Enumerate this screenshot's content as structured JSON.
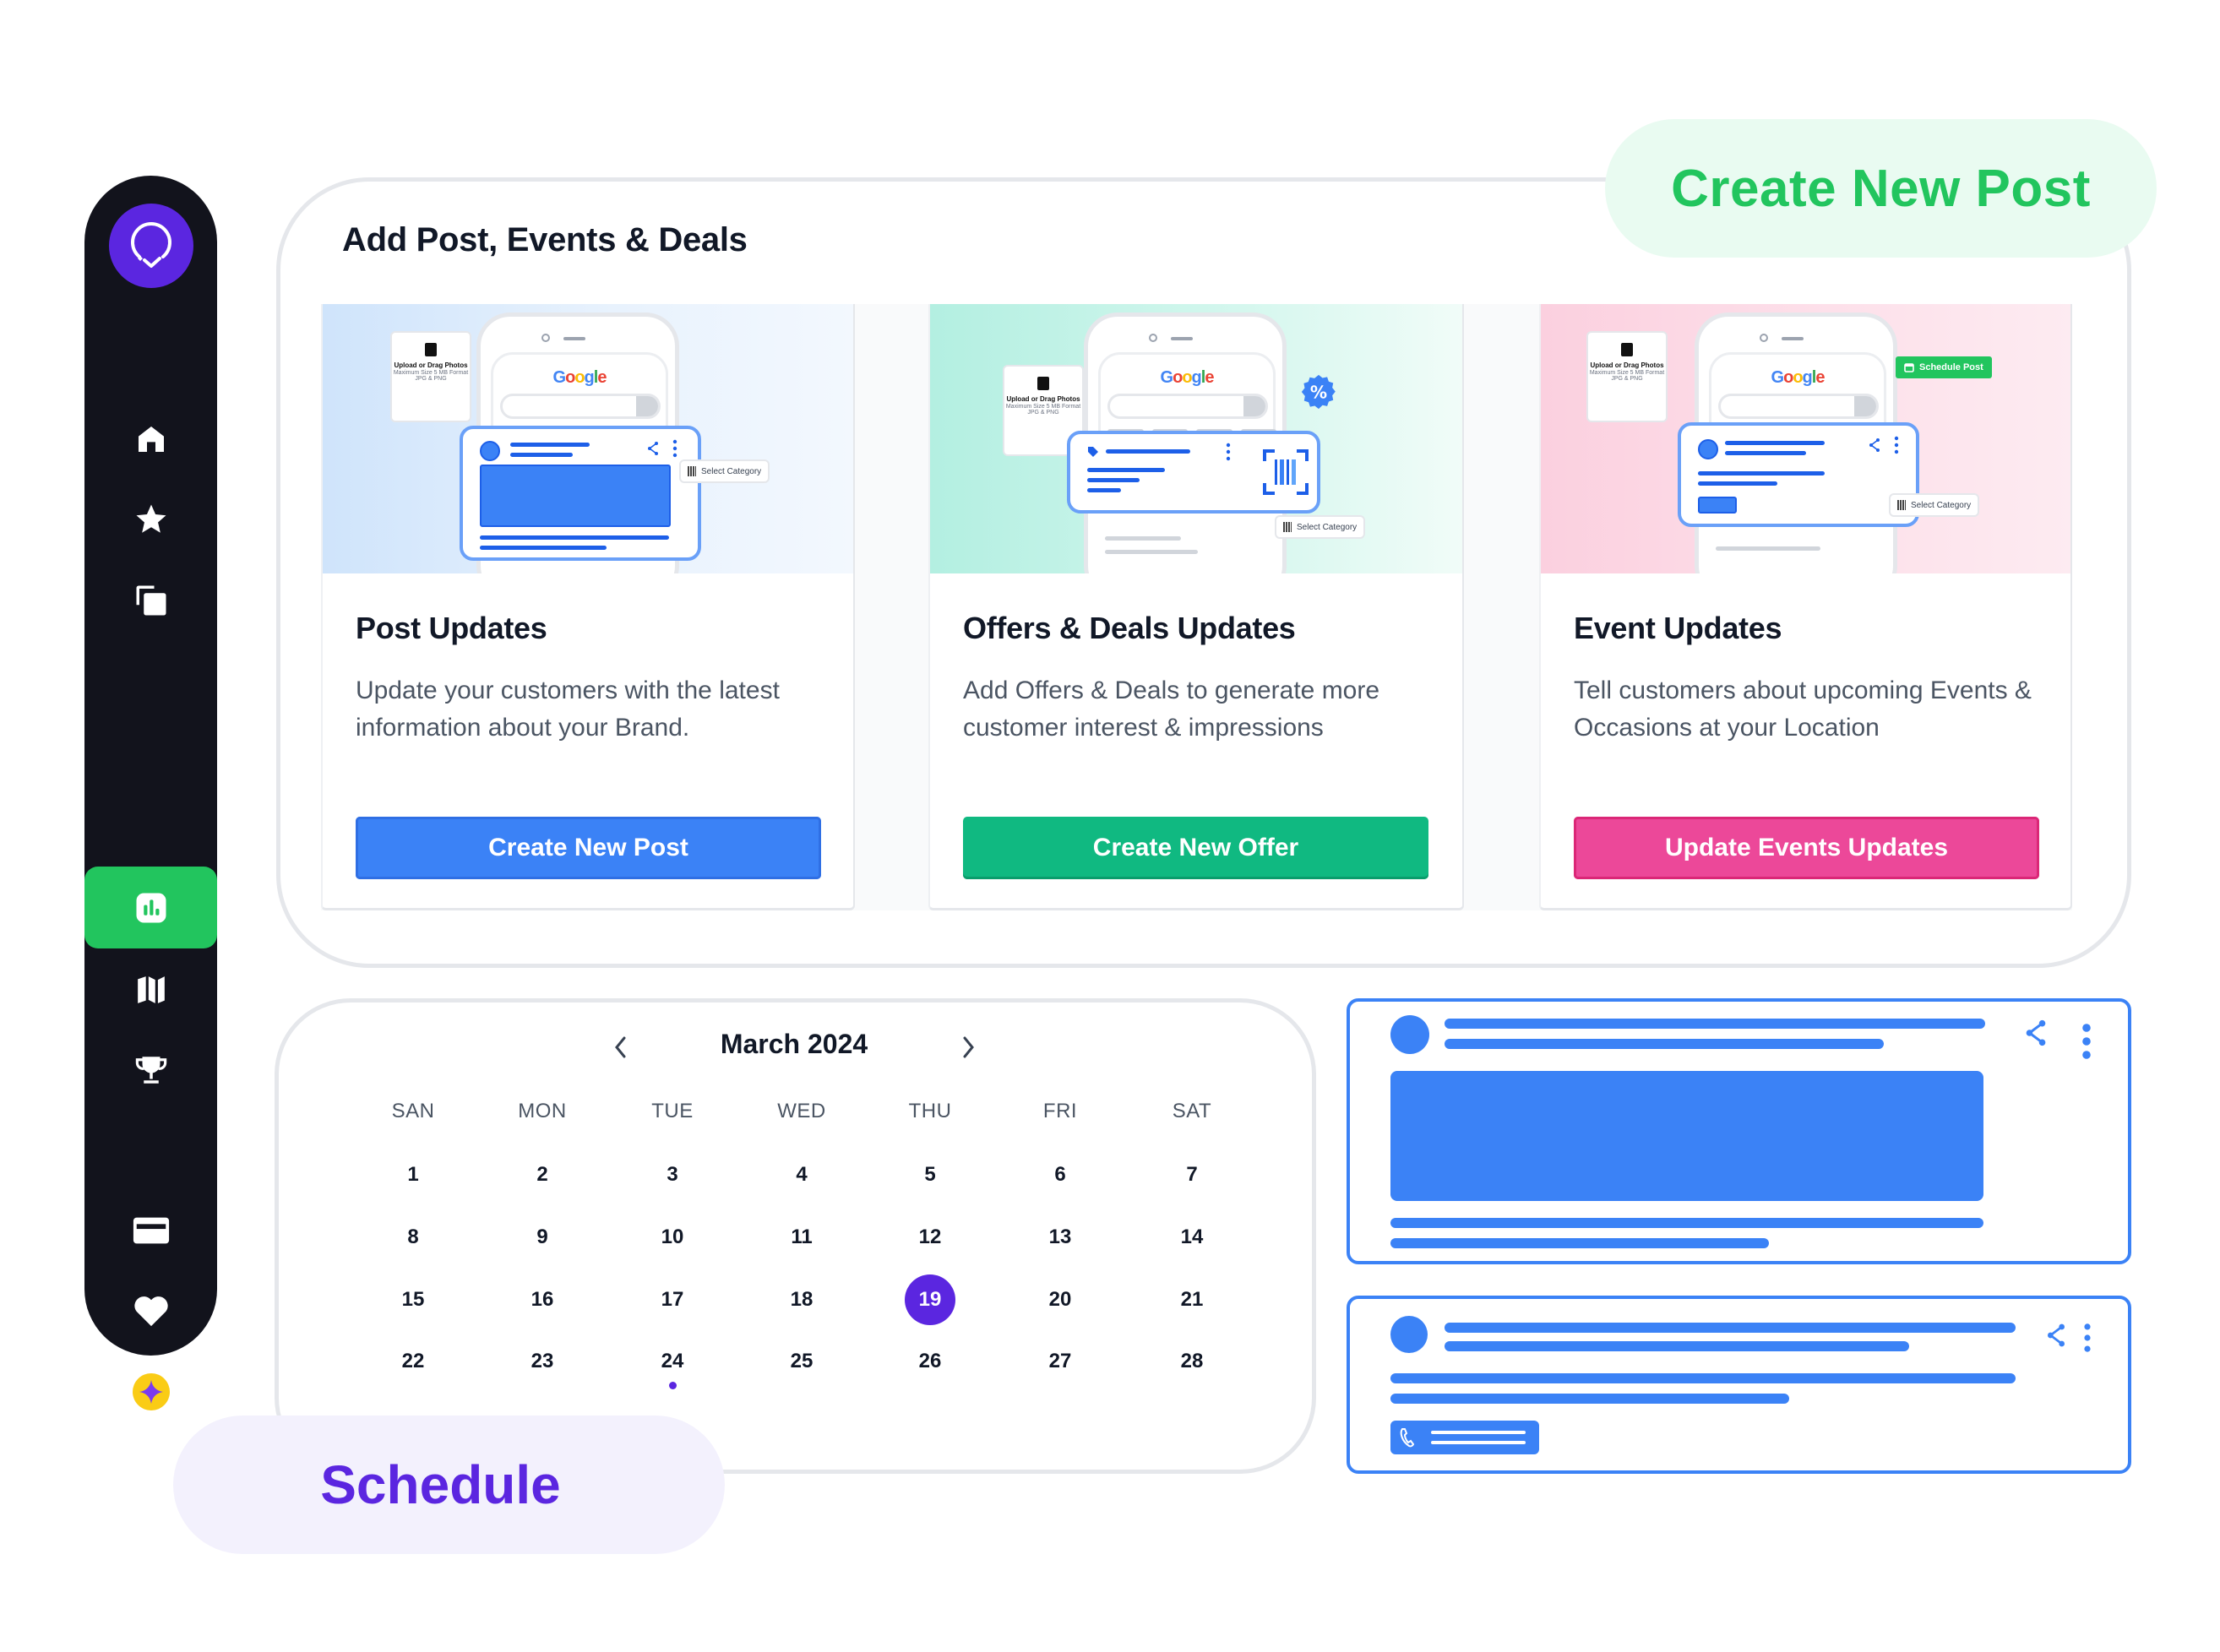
{
  "badges": {
    "create_new_post": "Create New Post",
    "schedule": "Schedule"
  },
  "colors": {
    "brand_purple": "#5B26E0",
    "active_green": "#22C55E",
    "post_blue": "#3B82F6",
    "offer_green": "#10B981",
    "event_pink": "#EC4899",
    "sidebar_bg": "#12131C"
  },
  "sidebar": {
    "logo": "location-check-logo",
    "items": [
      {
        "icon": "home-icon",
        "active": false
      },
      {
        "icon": "star-icon",
        "active": false
      },
      {
        "icon": "copy-icon",
        "active": false
      },
      {
        "icon": "bar-chart-icon",
        "active": true
      },
      {
        "icon": "map-icon",
        "active": false
      },
      {
        "icon": "trophy-icon",
        "active": false
      },
      {
        "icon": "credit-card-icon",
        "active": false
      },
      {
        "icon": "heart-icon",
        "active": false
      },
      {
        "icon": "sparkle-coin-icon",
        "active": false
      }
    ]
  },
  "main": {
    "title": "Add Post, Events & Deals",
    "cards": [
      {
        "title": "Post Updates",
        "description": "Update your customers with the latest information about your Brand.",
        "button": "Create New Post",
        "illustration": {
          "upload_title": "Upload or Drag Photos",
          "upload_note": "Maximum Size 5 MB Format JPG & PNG",
          "search_brand": "Google",
          "chip": "Select Category"
        }
      },
      {
        "title": "Offers & Deals Updates",
        "description": "Add Offers & Deals to generate more customer interest & impressions",
        "button": "Create New Offer",
        "illustration": {
          "upload_title": "Upload or Drag Photos",
          "upload_note": "Maximum Size 5 MB Format JPG & PNG",
          "search_brand": "Google",
          "chip": "Select Category",
          "badge": "%"
        }
      },
      {
        "title": "Event Updates",
        "description": "Tell customers about upcoming Events & Occasions at your Location",
        "button": "Update Events Updates",
        "illustration": {
          "upload_title": "Upload or Drag Photos",
          "upload_note": "Maximum Size 5 MB Format JPG & PNG",
          "search_brand": "Google",
          "chip": "Select Category",
          "schedule_chip": "Schedule Post"
        }
      }
    ]
  },
  "calendar": {
    "month_label": "March 2024",
    "prev_icon": "‹",
    "next_icon": "›",
    "weekdays": [
      "SAN",
      "MON",
      "TUE",
      "WED",
      "THU",
      "FRI",
      "SAT"
    ],
    "weeks": [
      [
        "1",
        "2",
        "3",
        "4",
        "5",
        "6",
        "7"
      ],
      [
        "8",
        "9",
        "10",
        "11",
        "12",
        "13",
        "14"
      ],
      [
        "15",
        "16",
        "17",
        "18",
        "19",
        "20",
        "21"
      ],
      [
        "22",
        "23",
        "24",
        "25",
        "26",
        "27",
        "28"
      ]
    ],
    "selected_day": "19",
    "event_days": [
      "24"
    ]
  },
  "preview_posts": [
    {
      "type": "image-post",
      "icons": [
        "share-icon",
        "more-vertical-icon"
      ]
    },
    {
      "type": "call-post",
      "icons": [
        "share-icon",
        "more-vertical-icon",
        "phone-icon"
      ]
    }
  ]
}
